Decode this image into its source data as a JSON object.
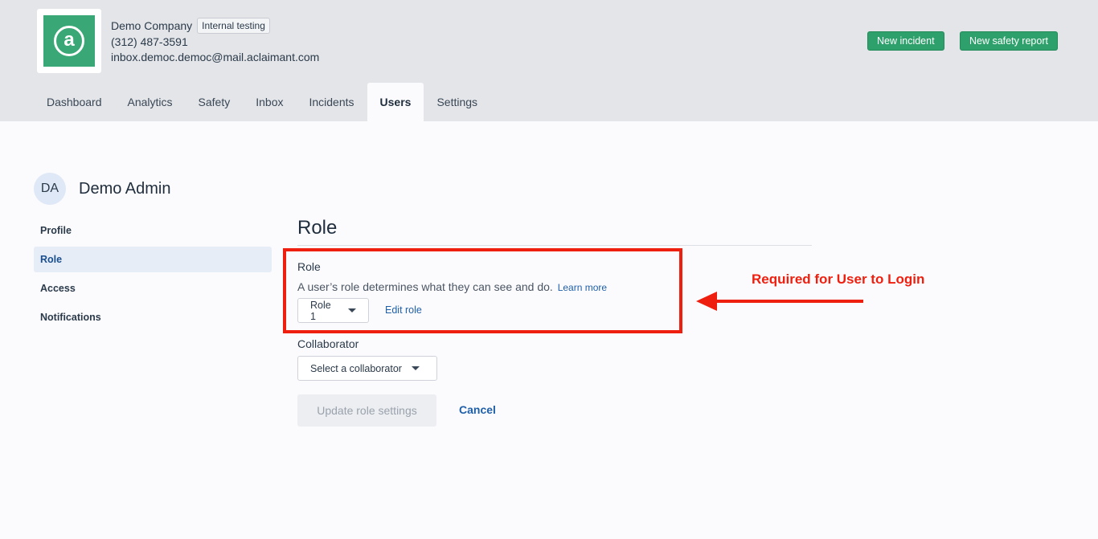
{
  "company": {
    "name": "Demo Company",
    "badge": "Internal testing",
    "phone": "(312) 487-3591",
    "email": "inbox.democ.democ@mail.aclaimant.com",
    "logo_icon": "aclaimant-logo-icon",
    "logo_color": "#3aa876"
  },
  "actions": {
    "new_incident": "New incident",
    "new_safety_report": "New safety report"
  },
  "nav_tabs": [
    {
      "label": "Dashboard"
    },
    {
      "label": "Analytics"
    },
    {
      "label": "Safety"
    },
    {
      "label": "Inbox"
    },
    {
      "label": "Incidents"
    },
    {
      "label": "Users",
      "active": true
    },
    {
      "label": "Settings"
    }
  ],
  "user": {
    "initials": "DA",
    "name": "Demo Admin"
  },
  "side_nav": [
    {
      "label": "Profile"
    },
    {
      "label": "Role",
      "active": true
    },
    {
      "label": "Access"
    },
    {
      "label": "Notifications"
    }
  ],
  "main": {
    "title": "Role",
    "role_label": "Role",
    "role_help": "A user’s role determines what they can see and do.",
    "learn_more": "Learn more",
    "role_value": "Role 1",
    "edit_role": "Edit role",
    "collaborator_label": "Collaborator",
    "collaborator_value": "Select a collaborator",
    "update_button": "Update role settings",
    "cancel": "Cancel"
  },
  "annotation": {
    "text": "Required for User to Login",
    "color": "#ee1f0f"
  }
}
